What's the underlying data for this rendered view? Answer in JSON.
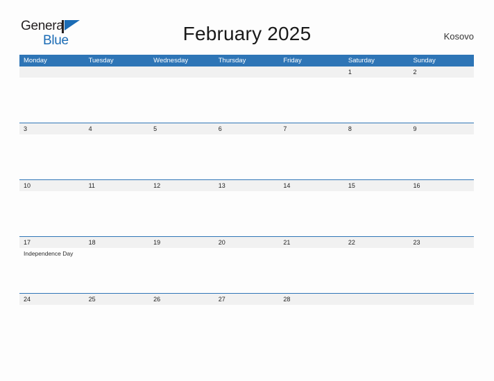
{
  "brand": {
    "word1": "General",
    "word2": "Blue",
    "flag_icon": "blue-pennant-flag-icon",
    "color_dark": "#231f20",
    "color_blue": "#1b6cb5"
  },
  "header": {
    "title": "February 2025",
    "country": "Kosovo"
  },
  "theme": {
    "header_blue": "#2e75b6",
    "date_band_gray": "#f1f1f1",
    "page_background": "#fdfdfd",
    "text_dark": "#222222"
  },
  "calendar": {
    "weekdays": [
      "Monday",
      "Tuesday",
      "Wednesday",
      "Thursday",
      "Friday",
      "Saturday",
      "Sunday"
    ],
    "weeks": [
      {
        "days": [
          {
            "date": "",
            "events": []
          },
          {
            "date": "",
            "events": []
          },
          {
            "date": "",
            "events": []
          },
          {
            "date": "",
            "events": []
          },
          {
            "date": "",
            "events": []
          },
          {
            "date": "1",
            "events": []
          },
          {
            "date": "2",
            "events": []
          }
        ]
      },
      {
        "days": [
          {
            "date": "3",
            "events": []
          },
          {
            "date": "4",
            "events": []
          },
          {
            "date": "5",
            "events": []
          },
          {
            "date": "6",
            "events": []
          },
          {
            "date": "7",
            "events": []
          },
          {
            "date": "8",
            "events": []
          },
          {
            "date": "9",
            "events": []
          }
        ]
      },
      {
        "days": [
          {
            "date": "10",
            "events": []
          },
          {
            "date": "11",
            "events": []
          },
          {
            "date": "12",
            "events": []
          },
          {
            "date": "13",
            "events": []
          },
          {
            "date": "14",
            "events": []
          },
          {
            "date": "15",
            "events": []
          },
          {
            "date": "16",
            "events": []
          }
        ]
      },
      {
        "days": [
          {
            "date": "17",
            "events": [
              "Independence Day"
            ]
          },
          {
            "date": "18",
            "events": []
          },
          {
            "date": "19",
            "events": []
          },
          {
            "date": "20",
            "events": []
          },
          {
            "date": "21",
            "events": []
          },
          {
            "date": "22",
            "events": []
          },
          {
            "date": "23",
            "events": []
          }
        ]
      },
      {
        "days": [
          {
            "date": "24",
            "events": []
          },
          {
            "date": "25",
            "events": []
          },
          {
            "date": "26",
            "events": []
          },
          {
            "date": "27",
            "events": []
          },
          {
            "date": "28",
            "events": []
          },
          {
            "date": "",
            "events": []
          },
          {
            "date": "",
            "events": []
          }
        ]
      }
    ]
  }
}
